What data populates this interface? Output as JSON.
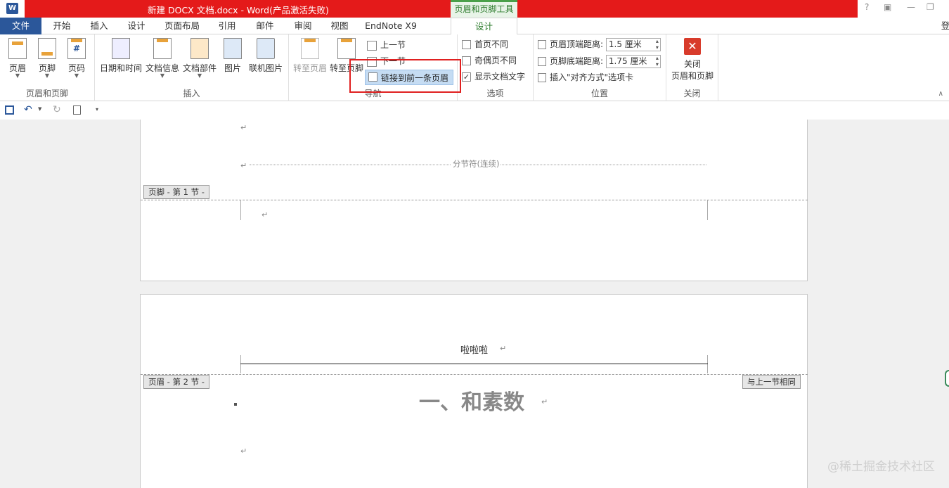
{
  "titlebar": {
    "app_icon": "W",
    "doc_title": "新建 DOCX 文档.docx -  Word(产品激活失败)",
    "context_tab": "页眉和页脚工具",
    "help_icon": "?",
    "restore_ribbon_icon": "▣",
    "minimize_icon": "—",
    "maximize_icon": "❐"
  },
  "menubar": {
    "tabs": [
      "文件",
      "开始",
      "插入",
      "设计",
      "页面布局",
      "引用",
      "邮件",
      "审阅",
      "视图",
      "EndNote X9"
    ],
    "context_tab": "设计",
    "account_partial": "登"
  },
  "ribbon": {
    "group1": {
      "label": "页眉和页脚",
      "buttons": [
        "页眉",
        "页脚",
        "页码"
      ]
    },
    "group2": {
      "label": "插入",
      "buttons": [
        "日期和时间",
        "文档信息",
        "文档部件",
        "图片",
        "联机图片"
      ]
    },
    "group3": {
      "label": "导航",
      "goto_header": "转至页眉",
      "goto_footer": "转至页脚",
      "prev": "上一节",
      "next": "下一节",
      "link_prev": "链接到前一条页眉"
    },
    "group4": {
      "label": "选项",
      "first_page": "首页不同",
      "odd_even": "奇偶页不同",
      "show_text": "显示文档文字",
      "show_text_checked": true
    },
    "group5": {
      "label": "位置",
      "header_dist_label": "页眉顶端距离:",
      "header_dist_value": "1.5 厘米",
      "footer_dist_label": "页脚底端距离:",
      "footer_dist_value": "1.75 厘米",
      "insert_align": "插入\"对齐方式\"选项卡"
    },
    "group6": {
      "label": "关闭",
      "close_line1": "关闭",
      "close_line2": "页眉和页脚"
    }
  },
  "document": {
    "para_mark": "↵",
    "section_break": "分节符(连续)",
    "footer_tag_1": "页脚 - 第 1 节 -",
    "header_tag_2": "页眉 - 第 2 节 -",
    "same_as_prev": "与上一节相同",
    "header_text": "啦啦啦",
    "heading": "一、和素数"
  },
  "watermark": "@稀土掘金技术社区"
}
